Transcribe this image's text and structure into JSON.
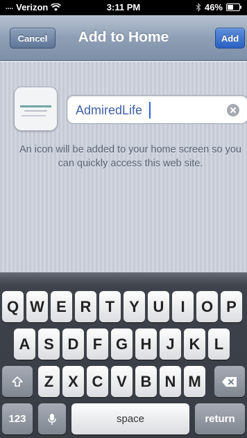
{
  "status_bar": {
    "signal": "....",
    "carrier": "Verizon",
    "time": "3:11 PM",
    "battery_percent": "46%",
    "icons": [
      "wifi-icon",
      "bluetooth-icon",
      "battery-icon"
    ]
  },
  "nav": {
    "title": "Add to Home",
    "cancel_label": "Cancel",
    "add_label": "Add"
  },
  "bookmark": {
    "name_value": "AdmiredLife",
    "description": "An icon will be added to your home screen so you can quickly access this web site."
  },
  "keyboard": {
    "row1": [
      "Q",
      "W",
      "E",
      "R",
      "T",
      "Y",
      "U",
      "I",
      "O",
      "P"
    ],
    "row2": [
      "A",
      "S",
      "D",
      "F",
      "G",
      "H",
      "J",
      "K",
      "L"
    ],
    "row3": [
      "Z",
      "X",
      "C",
      "V",
      "B",
      "N",
      "M"
    ],
    "numbers_label": "123",
    "space_label": "space",
    "return_label": "return"
  },
  "colors": {
    "nav_blue": "#8e9fb5",
    "add_button": "#2a61c2",
    "keyboard_bg": "#383c44"
  }
}
